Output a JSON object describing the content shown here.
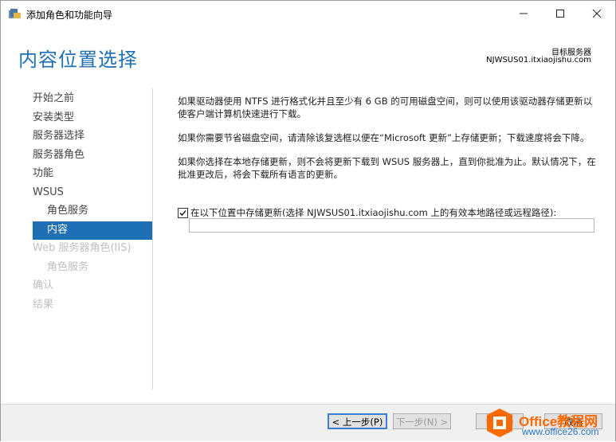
{
  "window": {
    "title": "添加角色和功能向导",
    "icons": {
      "app": "server-manager-icon",
      "minimize": "minimize-icon",
      "maximize": "maximize-icon",
      "close": "close-icon"
    }
  },
  "header": {
    "title": "内容位置选择",
    "dest_label": "目标服务器",
    "dest_server": "NJWSUS01.itxiaojishu.com"
  },
  "nav": {
    "items": [
      {
        "label": "开始之前",
        "state": "normal"
      },
      {
        "label": "安装类型",
        "state": "normal"
      },
      {
        "label": "服务器选择",
        "state": "normal"
      },
      {
        "label": "服务器角色",
        "state": "normal"
      },
      {
        "label": "功能",
        "state": "normal"
      },
      {
        "label": "WSUS",
        "state": "normal"
      },
      {
        "label": "角色服务",
        "state": "sub"
      },
      {
        "label": "内容",
        "state": "active"
      },
      {
        "label": "Web 服务器角色(IIS)",
        "state": "disabled"
      },
      {
        "label": "角色服务",
        "state": "disabled-sub"
      },
      {
        "label": "确认",
        "state": "disabled"
      },
      {
        "label": "结果",
        "state": "disabled"
      }
    ]
  },
  "content": {
    "para1": "如果驱动器使用 NTFS 进行格式化并且至少有 6 GB 的可用磁盘空间，则可以使用该驱动器存储更新以使客户端计算机快速进行下载。",
    "para2": "如果你需要节省磁盘空间，请清除该复选框以便在“Microsoft 更新”上存储更新；下载速度将会下降。",
    "para3": "如果你选择在本地存储更新，则不会将更新下载到 WSUS 服务器上，直到你批准为止。默认情况下，在批准更改后，将会下载所有语言的更新。",
    "checkbox_label": "在以下位置中存储更新(选择 NJWSUS01.itxiaojishu.com 上的有效本地路径或远程路径):",
    "checkbox_checked": true,
    "path_value": ""
  },
  "footer": {
    "prev_label": "< 上一步(P)",
    "next_label": "下一步(N) >",
    "install_label": "安装(I)",
    "cancel_label": "取消"
  },
  "watermark": {
    "brand": "Office教程网",
    "url": "www.office26.com"
  },
  "colors": {
    "accent": "#1f6fb5",
    "watermark_orange": "#ff6a00",
    "watermark_blue": "#2878c8"
  }
}
